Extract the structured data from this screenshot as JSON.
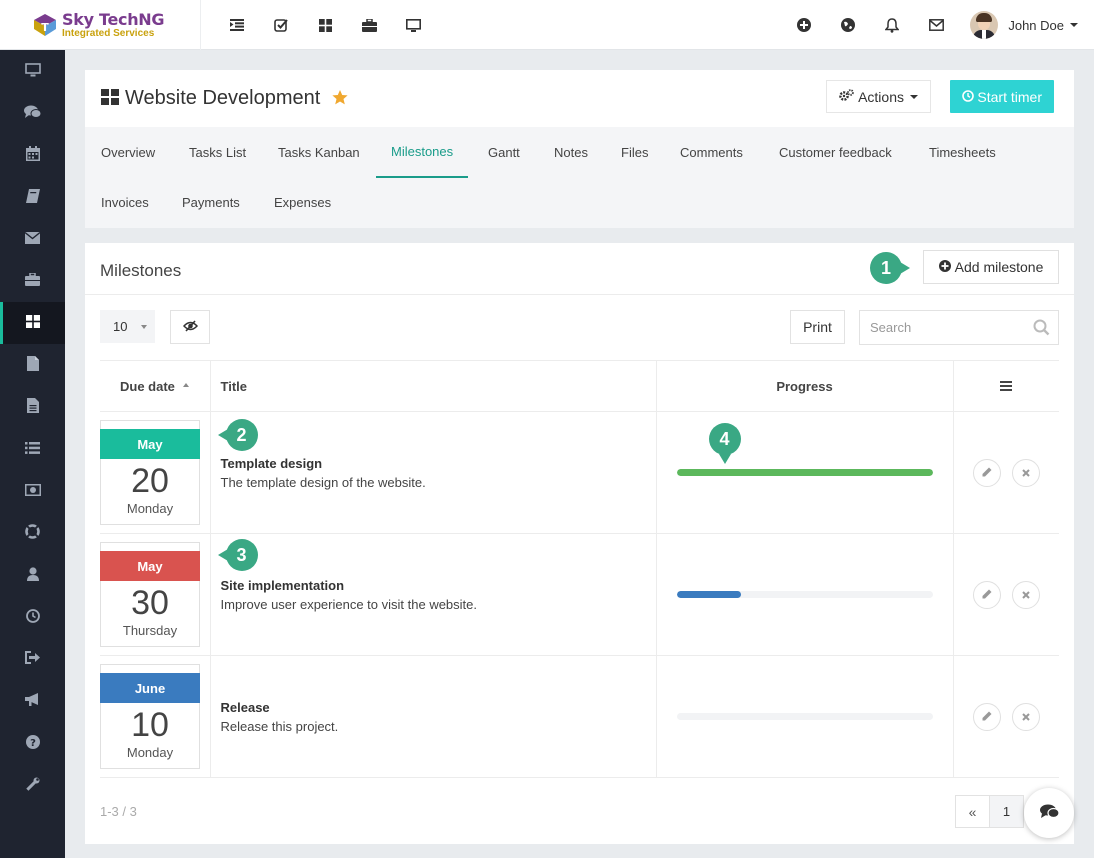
{
  "brand": {
    "name_part1": "Sky Tech",
    "name_part2": "NG",
    "tagline": "Integrated Services"
  },
  "topbar": {
    "left_icons": [
      "list-indent-icon",
      "check-square-icon",
      "grid-icon",
      "briefcase-icon",
      "monitor-icon"
    ],
    "right_icons": [
      "plus-circle-icon",
      "globe-icon",
      "bell-icon",
      "envelope-icon"
    ],
    "user_name": "John Doe"
  },
  "sidebar": {
    "items": [
      {
        "icon": "monitor-icon",
        "active": false
      },
      {
        "icon": "comments-icon",
        "active": false
      },
      {
        "icon": "calendar-icon",
        "active": false
      },
      {
        "icon": "book-icon",
        "active": false
      },
      {
        "icon": "envelope-icon",
        "active": false
      },
      {
        "icon": "briefcase-icon",
        "active": false
      },
      {
        "icon": "grid-icon",
        "active": true
      },
      {
        "icon": "file-icon",
        "active": false
      },
      {
        "icon": "file-text-icon",
        "active": false
      },
      {
        "icon": "list-icon",
        "active": false
      },
      {
        "icon": "money-icon",
        "active": false
      },
      {
        "icon": "lifebuoy-icon",
        "active": false
      },
      {
        "icon": "user-icon",
        "active": false
      },
      {
        "icon": "clock-icon",
        "active": false
      },
      {
        "icon": "sign-out-icon",
        "active": false
      },
      {
        "icon": "bullhorn-icon",
        "active": false
      },
      {
        "icon": "question-icon",
        "active": false
      },
      {
        "icon": "wrench-icon",
        "active": false
      }
    ]
  },
  "project": {
    "title": "Website Development",
    "actions_label": "Actions",
    "timer_label": "Start timer",
    "tabs": [
      "Overview",
      "Tasks List",
      "Tasks Kanban",
      "Milestones",
      "Gantt",
      "Notes",
      "Files",
      "Comments",
      "Customer feedback",
      "Timesheets",
      "Invoices",
      "Payments",
      "Expenses"
    ],
    "active_tab": "Milestones"
  },
  "milestones": {
    "title": "Milestones",
    "add_label": "Add milestone",
    "page_length": "10",
    "print_label": "Print",
    "search_placeholder": "Search",
    "columns": [
      "Due date",
      "Title",
      "Progress"
    ],
    "rows": [
      {
        "month": "May",
        "day": "20",
        "weekday": "Monday",
        "color": "#1abc9c",
        "title": "Template design",
        "description": "The template design of the website.",
        "progress": 100,
        "bar_color": "#5cb85c"
      },
      {
        "month": "May",
        "day": "30",
        "weekday": "Thursday",
        "color": "#d9534f",
        "title": "Site implementation",
        "description": "Improve user experience to visit the website.",
        "progress": 25,
        "bar_color": "#3a7bbf"
      },
      {
        "month": "June",
        "day": "10",
        "weekday": "Monday",
        "color": "#3a7bbf",
        "title": "Release",
        "description": "Release this project.",
        "progress": 0,
        "bar_color": "#3a7bbf"
      }
    ],
    "pager_info": "1-3 / 3",
    "pager_prev": "«",
    "pager_current": "1"
  },
  "callouts": [
    "1",
    "2",
    "3",
    "4"
  ],
  "colors": {
    "accent": "#1abc9c",
    "timer": "#2ed3d3",
    "callout": "#3aa884",
    "star": "#f0a830"
  }
}
